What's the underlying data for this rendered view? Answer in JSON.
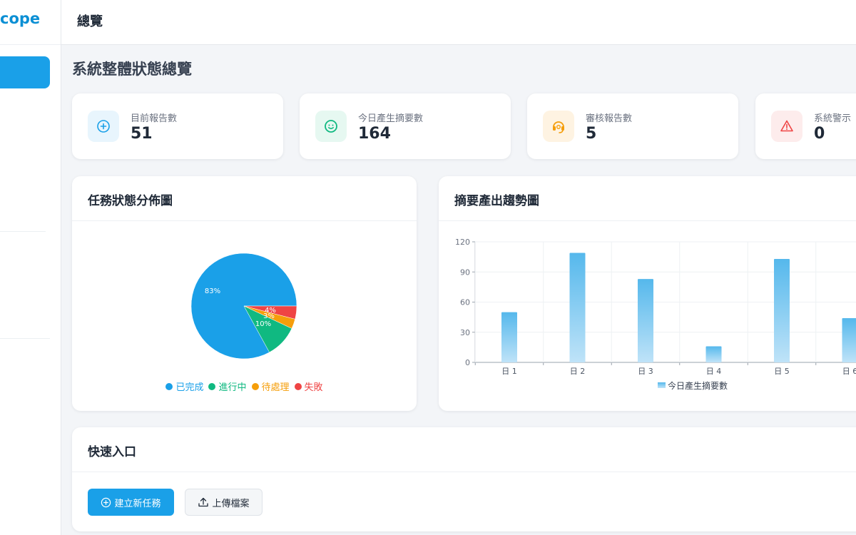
{
  "app": {
    "brand_fragment": "cope"
  },
  "topbar": {
    "title": "總覽"
  },
  "page": {
    "title": "系統整體狀態總覽"
  },
  "stats": [
    {
      "label": "目前報告數",
      "value": "51",
      "icon": "plus-circle-icon",
      "color": "#1aa0e8",
      "bg": "#e8f5fd"
    },
    {
      "label": "今日產生摘要數",
      "value": "164",
      "icon": "face-smile-icon",
      "color": "#10b981",
      "bg": "#e6f8f1"
    },
    {
      "label": "審核報告數",
      "value": "5",
      "icon": "headset-icon",
      "color": "#f59e0b",
      "bg": "#fef3e2"
    },
    {
      "label": "系統警示",
      "value": "0",
      "icon": "warning-triangle-icon",
      "color": "#ef4444",
      "bg": "#fdecec"
    }
  ],
  "pie_panel": {
    "title": "任務狀態分佈圖"
  },
  "bar_panel": {
    "title": "摘要產出趨勢圖"
  },
  "chart_data": [
    {
      "type": "pie",
      "title": "任務狀態分佈圖",
      "categories": [
        "已完成",
        "進行中",
        "待處理",
        "失敗"
      ],
      "values": [
        83,
        10,
        3,
        4
      ],
      "labels": [
        "83%",
        "10%",
        "3%",
        "4%"
      ],
      "colors": [
        "#1aa0e8",
        "#10b981",
        "#f59e0b",
        "#ef4444"
      ],
      "legend": "bottom"
    },
    {
      "type": "bar",
      "title": "摘要產出趨勢圖",
      "categories": [
        "日 1",
        "日 2",
        "日 3",
        "日 4",
        "日 5",
        "日 6"
      ],
      "series": [
        {
          "name": "今日產生摘要數",
          "values": [
            50,
            109,
            83,
            16,
            103,
            44
          ]
        }
      ],
      "yticks": [
        "0",
        "30",
        "60",
        "90",
        "120"
      ],
      "ylim": [
        0,
        120
      ],
      "grid": true,
      "legend": "bottom",
      "color": "#1aa0e8"
    }
  ],
  "quick_panel": {
    "title": "快速入口",
    "create_label": "建立新任務",
    "upload_label": "上傳檔案"
  }
}
